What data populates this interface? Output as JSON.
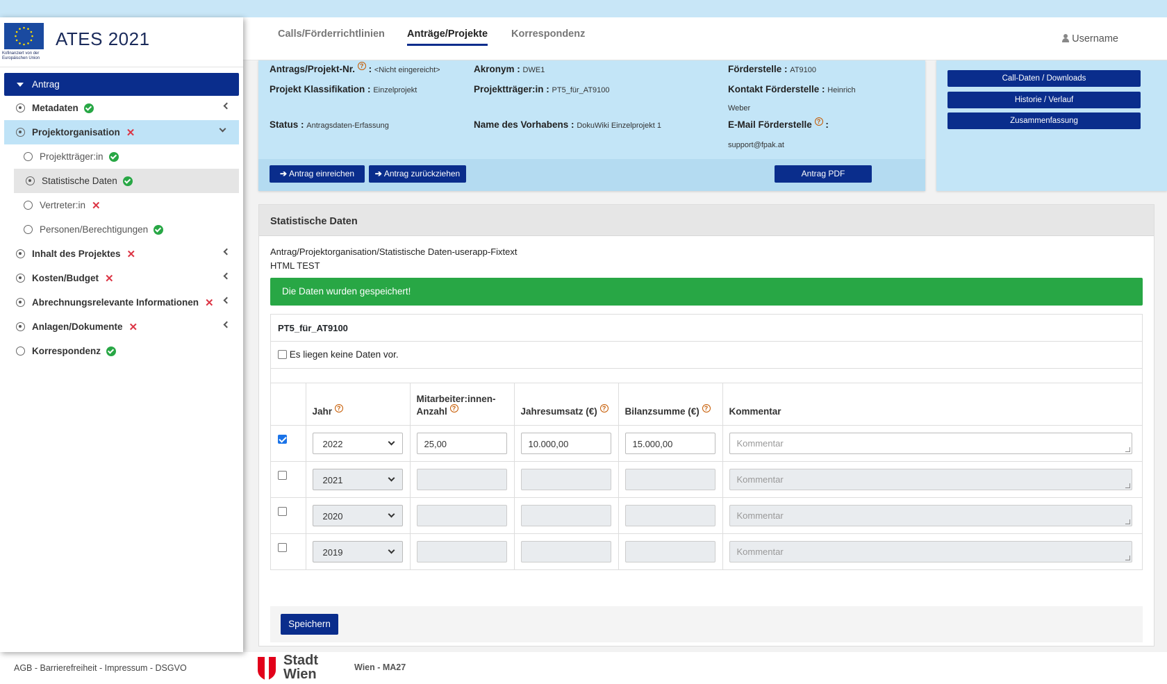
{
  "app": {
    "title": "ATES 2021",
    "eu_text": "Kofinanziert von der Europäischen Union"
  },
  "tabs": [
    {
      "label": "Calls/Förderrichtlinien"
    },
    {
      "label": "Anträge/Projekte",
      "active": true
    },
    {
      "label": "Korrespondenz"
    }
  ],
  "user": {
    "name": "Username"
  },
  "sidebar": {
    "root": "Antrag",
    "items": [
      {
        "label": "Metadaten",
        "status": "ok"
      },
      {
        "label": "Projektorganisation",
        "status": "error"
      },
      {
        "label": "Projektträger:in",
        "status": "ok"
      },
      {
        "label": "Statistische Daten",
        "status": "ok"
      },
      {
        "label": "Vertreter:in",
        "status": "error"
      },
      {
        "label": "Personen/Berechtigungen",
        "status": "ok"
      },
      {
        "label": "Inhalt des Projektes",
        "status": "error"
      },
      {
        "label": "Kosten/Budget",
        "status": "error"
      },
      {
        "label": "Abrechnungsrelevante Informationen",
        "status": "error"
      },
      {
        "label": "Anlagen/Dokumente",
        "status": "error"
      },
      {
        "label": "Korrespondenz",
        "status": "ok"
      }
    ]
  },
  "info": {
    "antragsnr_label": "Antrags/Projekt-Nr.",
    "antragsnr_value": "<Nicht eingereicht>",
    "akronym_label": "Akronym :",
    "akronym_value": "DWE1",
    "foerderstelle_label": "Förderstelle :",
    "foerderstelle_value": "AT9100",
    "klassifikation_label": "Projekt Klassifikation :",
    "klassifikation_value": "Einzelprojekt",
    "traeger_label": "Projektträger:in :",
    "traeger_value": "PT5_für_AT9100",
    "kontakt_label": "Kontakt Förderstelle :",
    "kontakt_value1": "Heinrich",
    "kontakt_value2": "Weber",
    "status_label": "Status :",
    "status_value": "Antragsdaten-Erfassung",
    "vorhaben_label": "Name des Vorhabens :",
    "vorhaben_value": "DokuWiki Einzelprojekt 1",
    "email_label": "E-Mail Förderstelle",
    "email_value": "support@fpak.at",
    "colon": ":",
    "btn_einreichen": "Antrag einreichen",
    "btn_zurueckziehen": "Antrag zurückziehen",
    "btn_pdf": "Antrag PDF"
  },
  "side_buttons": {
    "calldaten": "Call-Daten / Downloads",
    "historie": "Historie / Verlauf",
    "zusammenfassung": "Zusammenfassung"
  },
  "section": {
    "title": "Statistische Daten",
    "fixtext1": "Antrag/Projektorganisation/Statistische Daten-userapp-Fixtext",
    "fixtext2": "HTML TEST",
    "alert": "Die Daten wurden gespeichert!",
    "org": "PT5_für_AT9100",
    "nodata": "Es liegen keine Daten vor.",
    "save": "Speichern"
  },
  "table": {
    "headers": {
      "jahr": "Jahr",
      "mitarbeiter1": "Mitarbeiter:innen-",
      "mitarbeiter2": "Anzahl",
      "umsatz": "Jahresumsatz (€)",
      "bilanz": "Bilanzsumme (€)",
      "kommentar": "Kommentar"
    },
    "comment_placeholder": "Kommentar",
    "rows": [
      {
        "checked": true,
        "jahr": "2022",
        "mitarbeiter": "25,00",
        "umsatz": "10.000,00",
        "bilanz": "15.000,00"
      },
      {
        "checked": false,
        "jahr": "2021",
        "mitarbeiter": "",
        "umsatz": "",
        "bilanz": ""
      },
      {
        "checked": false,
        "jahr": "2020",
        "mitarbeiter": "",
        "umsatz": "",
        "bilanz": ""
      },
      {
        "checked": false,
        "jahr": "2019",
        "mitarbeiter": "",
        "umsatz": "",
        "bilanz": ""
      }
    ]
  },
  "footer": {
    "links": "AGB - Barrierefreiheit - Impressum - DSGVO",
    "stadt1": "Stadt",
    "stadt2": "Wien",
    "ma": "Wien - MA27"
  },
  "colors": {
    "primary": "#0a2d8c",
    "light_blue": "#c3e5f7",
    "success": "#28a745",
    "error": "#dc3545"
  }
}
